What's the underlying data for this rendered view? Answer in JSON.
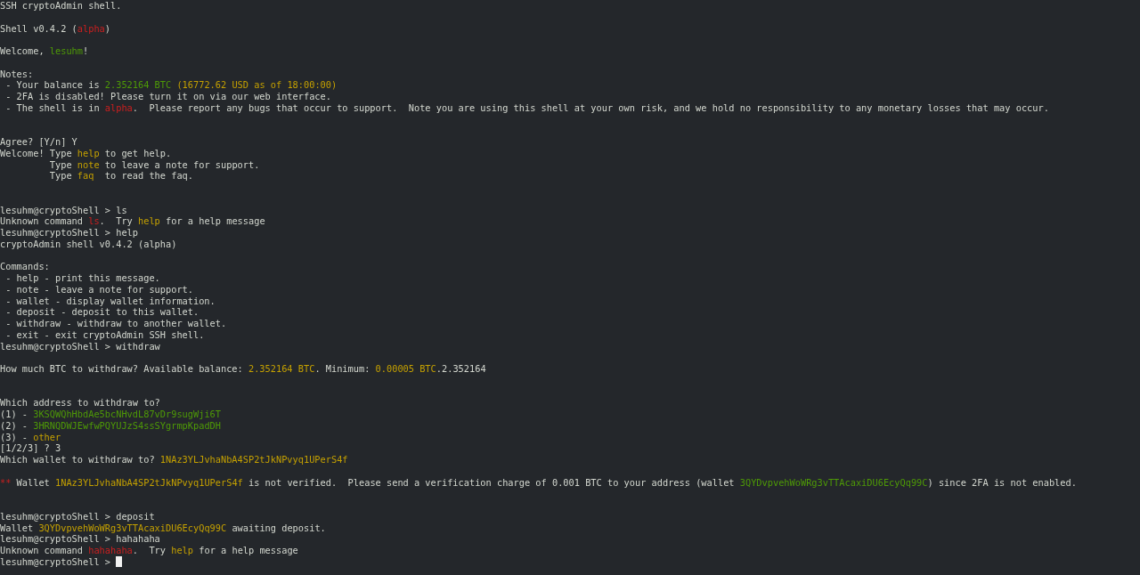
{
  "terminal": {
    "lines": [
      {
        "kind": "text",
        "segments": [
          {
            "text": "SSH cryptoAdmin shell.",
            "kind": "plain"
          }
        ]
      },
      {
        "kind": "blank"
      },
      {
        "kind": "text",
        "segments": [
          {
            "text": "Shell v0.4.2 (",
            "kind": "plain"
          },
          {
            "text": "alpha",
            "kind": "red"
          },
          {
            "text": ")",
            "kind": "plain"
          }
        ]
      },
      {
        "kind": "blank"
      },
      {
        "kind": "text",
        "segments": [
          {
            "text": "Welcome, ",
            "kind": "plain"
          },
          {
            "text": "lesuhm",
            "kind": "green"
          },
          {
            "text": "!",
            "kind": "plain"
          }
        ]
      },
      {
        "kind": "blank"
      },
      {
        "kind": "text",
        "segments": [
          {
            "text": "Notes:",
            "kind": "plain"
          }
        ]
      },
      {
        "kind": "text",
        "segments": [
          {
            "text": " - Your balance is ",
            "kind": "plain"
          },
          {
            "text": "2.352164 BTC",
            "kind": "green"
          },
          {
            "text": " (16772.62 USD as of 18:00:00)",
            "kind": "yellow"
          }
        ]
      },
      {
        "kind": "text",
        "segments": [
          {
            "text": " - 2FA is disabled! Please turn it on via our web interface.",
            "kind": "plain"
          }
        ]
      },
      {
        "kind": "text",
        "segments": [
          {
            "text": " - The shell is in ",
            "kind": "plain"
          },
          {
            "text": "alpha",
            "kind": "red"
          },
          {
            "text": ".  Please report any bugs that occur to support.  Note you are using this shell at your own risk, and we hold no responsibility to any monetary losses that may occur.",
            "kind": "plain"
          }
        ]
      },
      {
        "kind": "blank"
      },
      {
        "kind": "blank"
      },
      {
        "kind": "text",
        "segments": [
          {
            "text": "Agree? [Y/n] Y",
            "kind": "plain"
          }
        ]
      },
      {
        "kind": "text",
        "segments": [
          {
            "text": "Welcome! Type ",
            "kind": "plain"
          },
          {
            "text": "help",
            "kind": "yellow"
          },
          {
            "text": " to get help.",
            "kind": "plain"
          }
        ]
      },
      {
        "kind": "text",
        "segments": [
          {
            "text": "         Type ",
            "kind": "plain"
          },
          {
            "text": "note",
            "kind": "yellow"
          },
          {
            "text": " to leave a note for support.",
            "kind": "plain"
          }
        ]
      },
      {
        "kind": "text",
        "segments": [
          {
            "text": "         Type ",
            "kind": "plain"
          },
          {
            "text": "faq",
            "kind": "yellow"
          },
          {
            "text": "  to read the faq.",
            "kind": "plain"
          }
        ]
      },
      {
        "kind": "blank"
      },
      {
        "kind": "blank"
      },
      {
        "kind": "text",
        "segments": [
          {
            "text": "lesuhm@cryptoShell > ls",
            "kind": "plain"
          }
        ]
      },
      {
        "kind": "text",
        "segments": [
          {
            "text": "Unknown command ",
            "kind": "plain"
          },
          {
            "text": "ls",
            "kind": "red"
          },
          {
            "text": ".  Try ",
            "kind": "plain"
          },
          {
            "text": "help",
            "kind": "yellow"
          },
          {
            "text": " for a help message",
            "kind": "plain"
          }
        ]
      },
      {
        "kind": "text",
        "segments": [
          {
            "text": "lesuhm@cryptoShell > help",
            "kind": "plain"
          }
        ]
      },
      {
        "kind": "text",
        "segments": [
          {
            "text": "cryptoAdmin shell v0.4.2 (alpha)",
            "kind": "plain"
          }
        ]
      },
      {
        "kind": "blank"
      },
      {
        "kind": "text",
        "segments": [
          {
            "text": "Commands:",
            "kind": "plain"
          }
        ]
      },
      {
        "kind": "text",
        "segments": [
          {
            "text": " - help - print this message.",
            "kind": "plain"
          }
        ]
      },
      {
        "kind": "text",
        "segments": [
          {
            "text": " - note - leave a note for support.",
            "kind": "plain"
          }
        ]
      },
      {
        "kind": "text",
        "segments": [
          {
            "text": " - wallet - display wallet information.",
            "kind": "plain"
          }
        ]
      },
      {
        "kind": "text",
        "segments": [
          {
            "text": " - deposit - deposit to this wallet.",
            "kind": "plain"
          }
        ]
      },
      {
        "kind": "text",
        "segments": [
          {
            "text": " - withdraw - withdraw to another wallet.",
            "kind": "plain"
          }
        ]
      },
      {
        "kind": "text",
        "segments": [
          {
            "text": " - exit - exit cryptoAdmin SSH shell.",
            "kind": "plain"
          }
        ]
      },
      {
        "kind": "text",
        "segments": [
          {
            "text": "lesuhm@cryptoShell > withdraw",
            "kind": "plain"
          }
        ]
      },
      {
        "kind": "blank"
      },
      {
        "kind": "text",
        "segments": [
          {
            "text": "How much BTC to withdraw? Available balance: ",
            "kind": "plain"
          },
          {
            "text": "2.352164 BTC",
            "kind": "yellow"
          },
          {
            "text": ". Minimum: ",
            "kind": "plain"
          },
          {
            "text": "0.00005 BTC",
            "kind": "yellow"
          },
          {
            "text": ".2.352164",
            "kind": "plain"
          }
        ]
      },
      {
        "kind": "blank"
      },
      {
        "kind": "blank"
      },
      {
        "kind": "text",
        "segments": [
          {
            "text": "Which address to withdraw to?",
            "kind": "plain"
          }
        ]
      },
      {
        "kind": "text",
        "segments": [
          {
            "text": "(1) - ",
            "kind": "plain"
          },
          {
            "text": "3KSQWQhHbdAe5bcNHvdL87vDr9sugWji6T",
            "kind": "green"
          }
        ]
      },
      {
        "kind": "text",
        "segments": [
          {
            "text": "(2) - ",
            "kind": "plain"
          },
          {
            "text": "3HRNQDWJEwfwPQYUJzS4ssSYgrmpKpadDH",
            "kind": "green"
          }
        ]
      },
      {
        "kind": "text",
        "segments": [
          {
            "text": "(3) - ",
            "kind": "plain"
          },
          {
            "text": "other",
            "kind": "yellow"
          }
        ]
      },
      {
        "kind": "text",
        "segments": [
          {
            "text": "[1/2/3] ? 3",
            "kind": "plain"
          }
        ]
      },
      {
        "kind": "text",
        "segments": [
          {
            "text": "Which wallet to withdraw to? ",
            "kind": "plain"
          },
          {
            "text": "1NAz3YLJvhaNbA4SP2tJkNPvyq1UPerS4f",
            "kind": "yellow"
          }
        ]
      },
      {
        "kind": "blank"
      },
      {
        "kind": "text",
        "segments": [
          {
            "text": "**",
            "kind": "red"
          },
          {
            "text": " Wallet ",
            "kind": "plain"
          },
          {
            "text": "1NAz3YLJvhaNbA4SP2tJkNPvyq1UPerS4f",
            "kind": "yellow"
          },
          {
            "text": " is not verified.  Please send a verification charge of 0.001 BTC to your address (wallet ",
            "kind": "plain"
          },
          {
            "text": "3QYDvpvehWoWRg3vTTAcaxiDU6EcyQq99C",
            "kind": "green"
          },
          {
            "text": ") since 2FA is not enabled.",
            "kind": "plain"
          }
        ]
      },
      {
        "kind": "blank"
      },
      {
        "kind": "blank"
      },
      {
        "kind": "text",
        "segments": [
          {
            "text": "lesuhm@cryptoShell > deposit",
            "kind": "plain"
          }
        ]
      },
      {
        "kind": "text",
        "segments": [
          {
            "text": "Wallet ",
            "kind": "plain"
          },
          {
            "text": "3QYDvpvehWoWRg3vTTAcaxiDU6EcyQq99C",
            "kind": "yellow"
          },
          {
            "text": " awaiting deposit.",
            "kind": "plain"
          }
        ]
      },
      {
        "kind": "text",
        "segments": [
          {
            "text": "lesuhm@cryptoShell > hahahaha",
            "kind": "plain"
          }
        ]
      },
      {
        "kind": "text",
        "segments": [
          {
            "text": "Unknown command ",
            "kind": "plain"
          },
          {
            "text": "hahahaha",
            "kind": "red"
          },
          {
            "text": ".  Try ",
            "kind": "plain"
          },
          {
            "text": "help",
            "kind": "yellow"
          },
          {
            "text": " for a help message",
            "kind": "plain"
          }
        ]
      },
      {
        "kind": "prompt",
        "segments": [
          {
            "text": "lesuhm@cryptoShell > ",
            "kind": "plain"
          }
        ]
      }
    ]
  }
}
